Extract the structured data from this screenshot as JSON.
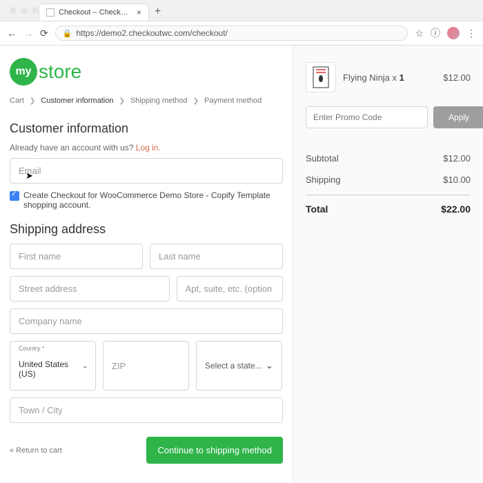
{
  "browser": {
    "tab_title": "Checkout – Checkout for Woo",
    "url": "https://demo2.checkoutwc.com/checkout/"
  },
  "logo": {
    "my": "my",
    "store": "store"
  },
  "breadcrumbs": {
    "a": "Cart",
    "b": "Customer information",
    "c": "Shipping method",
    "d": "Payment method"
  },
  "customer": {
    "heading": "Customer information",
    "have_text": "Already have an account with us? ",
    "login": "Log in.",
    "email_placeholder": "Email",
    "create_label": "Create Checkout for WooCommerce Demo Store - Copify Template shopping account."
  },
  "shipping": {
    "heading": "Shipping address",
    "first": "First name",
    "last": "Last name",
    "street": "Street address",
    "apt": "Apt, suite, etc. (option",
    "company": "Company name",
    "country_label": "Country *",
    "country_value": "United States (US)",
    "zip": "ZIP",
    "state": "Select a state...",
    "town": "Town / City"
  },
  "footer": {
    "return": "« Return to cart",
    "continue": "Continue to shipping method"
  },
  "order": {
    "product_name": "Flying Ninja x ",
    "qty": "1",
    "product_price": "$12.00",
    "promo_placeholder": "Enter Promo Code",
    "apply": "Apply",
    "subtotal_label": "Subtotal",
    "subtotal": "$12.00",
    "shipping_label": "Shipping",
    "shipping": "$10.00",
    "total_label": "Total",
    "total": "$22.00"
  }
}
